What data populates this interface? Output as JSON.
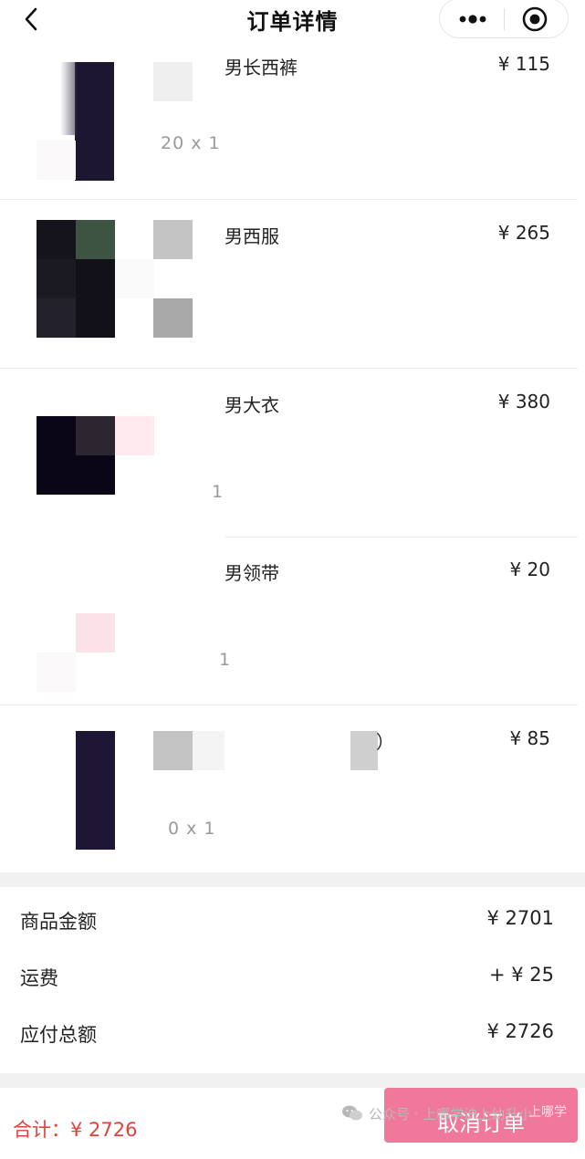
{
  "header": {
    "title": "订单详情"
  },
  "products": [
    {
      "name": "男长西裤",
      "price": "¥ 115",
      "qty": "20  x 1"
    },
    {
      "name": "男西服",
      "price": "¥ 265",
      "qty": ""
    },
    {
      "name": "男大衣",
      "price": "¥ 380",
      "qty": "1"
    },
    {
      "name": "男领带",
      "price": "¥ 20",
      "qty": "1"
    },
    {
      "name": "）",
      "price": "¥ 85",
      "qty": "0  x 1"
    }
  ],
  "summary": {
    "goods_label": "商品金额",
    "goods_value": "¥ 2701",
    "shipping_label": "运费",
    "shipping_value": "+ ¥ 25",
    "payable_label": "应付总额",
    "payable_value": "¥ 2726"
  },
  "footer": {
    "total": "合计：¥ 2726",
    "cancel_button": "取消订单",
    "watermark": "公众号 · 上哪学沪上幼升小",
    "watermark_tail": "上哪学"
  },
  "colors": {
    "accent_red": "#e0423c",
    "button_pink": "#f0789a"
  }
}
